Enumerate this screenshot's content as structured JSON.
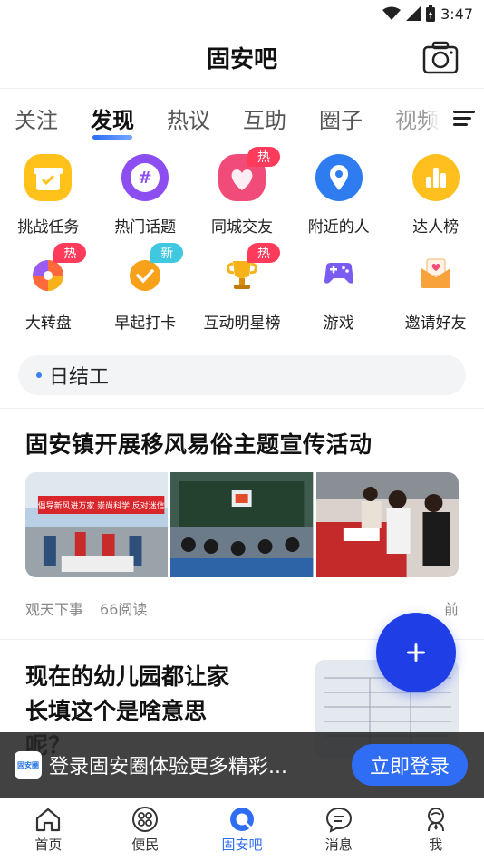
{
  "status_bar": {
    "time": "3:47"
  },
  "header": {
    "title": "固安吧"
  },
  "tabs": [
    {
      "label": "关注"
    },
    {
      "label": "发现"
    },
    {
      "label": "热议"
    },
    {
      "label": "互助"
    },
    {
      "label": "圈子"
    },
    {
      "label": "视频"
    }
  ],
  "features": [
    {
      "label": "挑战任务",
      "icon": "gift-icon",
      "badge": ""
    },
    {
      "label": "热门话题",
      "icon": "hashtag-icon",
      "badge": ""
    },
    {
      "label": "同城交友",
      "icon": "heart-icon",
      "badge": "热"
    },
    {
      "label": "附近的人",
      "icon": "location-pin-icon",
      "badge": ""
    },
    {
      "label": "达人榜",
      "icon": "bar-chart-icon",
      "badge": ""
    },
    {
      "label": "大转盘",
      "icon": "wheel-icon",
      "badge": "热"
    },
    {
      "label": "早起打卡",
      "icon": "checkmark-icon",
      "badge": "新"
    },
    {
      "label": "互动明星榜",
      "icon": "trophy-icon",
      "badge": "热"
    },
    {
      "label": "游戏",
      "icon": "gamepad-icon",
      "badge": ""
    },
    {
      "label": "邀请好友",
      "icon": "envelope-icon",
      "badge": ""
    }
  ],
  "topic_tag": {
    "label": "日结工"
  },
  "posts": [
    {
      "title": "固安镇开展移风易俗主题宣传活动",
      "source": "观天下事",
      "reads": "66阅读",
      "time": "前",
      "photo_banner_text": "倡导新风进万家  崇尚科学  反对迷信"
    },
    {
      "title": "现在的幼儿园都让家长填这个是啥意思呢",
      "title_line1": "现在的幼儿园都让家",
      "title_line2": "长填这个是啥意思",
      "title_line3": "呢？"
    }
  ],
  "login_banner": {
    "text": "登录固安圈体验更多精彩...",
    "button": "立即登录",
    "logo_text": "固安圈"
  },
  "bottom_nav": [
    {
      "label": "首页",
      "icon": "home-icon"
    },
    {
      "label": "便民",
      "icon": "grid-apps-icon"
    },
    {
      "label": "固安吧",
      "icon": "chat-bubble-icon",
      "active": true
    },
    {
      "label": "消息",
      "icon": "message-icon"
    },
    {
      "label": "我",
      "icon": "profile-icon"
    }
  ],
  "colors": {
    "accent": "#2f6df5",
    "fab": "#1f3ee6",
    "hot_badge": "#ff3b5c",
    "new_badge": "#40c8e0"
  }
}
